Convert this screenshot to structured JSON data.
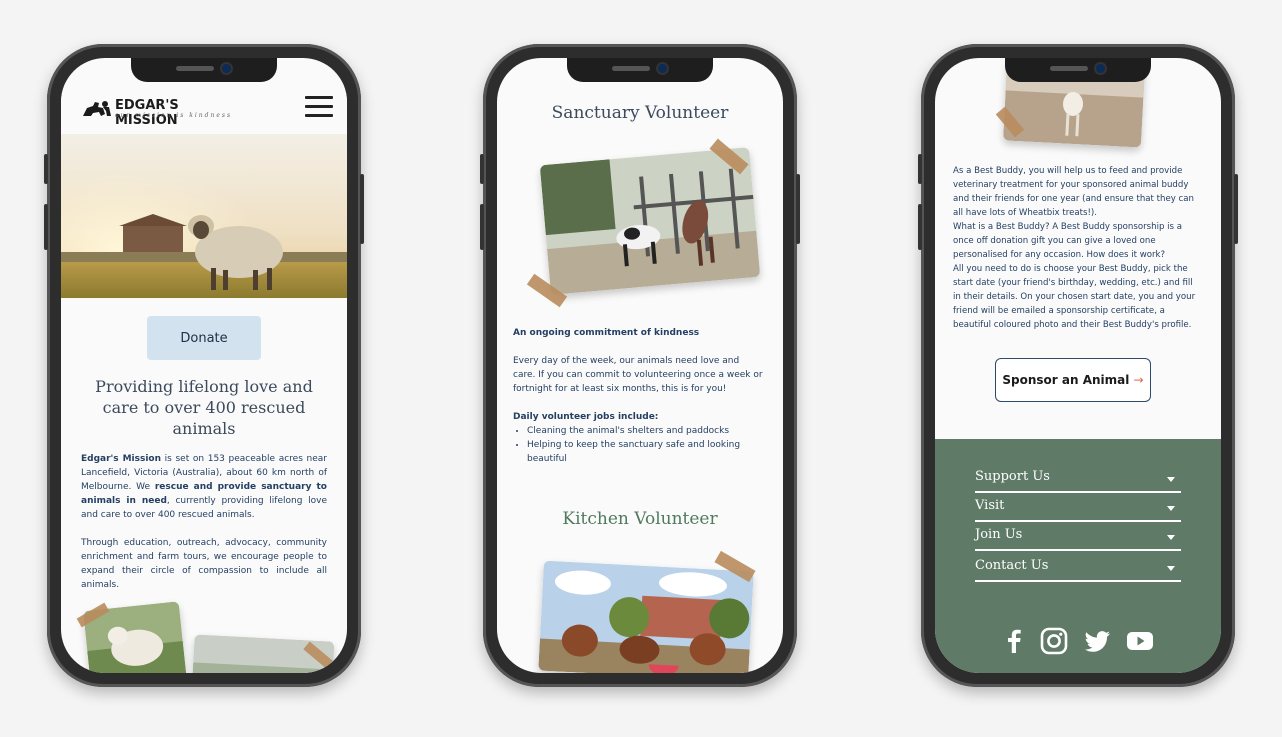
{
  "phone1": {
    "brand": "EDGAR'S MISSION",
    "tagline": "our mission is kindness",
    "donate_label": "Donate",
    "heading": "Providing lifelong love and care to over 400 rescued animals",
    "para1": {
      "s1": "Edgar's Mission",
      "s2": " is set on 153 peaceable acres near Lancefield, Victoria (Australia), about 60 km north of Melbourne. We ",
      "s3": "rescue and provide sanctuary to animals in need",
      "s4": ", currently providing lifelong love and care to over 400 rescued animals."
    },
    "para2": "Through education, outreach, advocacy, community enrichment and farm tours, we encourage people to expand their circle of compassion to include all animals."
  },
  "phone2": {
    "title1": "Sanctuary Volunteer",
    "intro_heading": "An ongoing commitment of kindness",
    "intro_body": "Every day of the week, our animals need love and care. If you can commit to volunteering once a week or fortnight for at least six months, this is for you!",
    "jobs_heading": "Daily volunteer jobs include:",
    "jobs": [
      "Cleaning the animal's shelters and paddocks",
      "Helping to keep the sanctuary safe and looking beautiful"
    ],
    "title2": "Kitchen Volunteer"
  },
  "phone3": {
    "p1": "As a Best Buddy, you will help us to feed and provide veterinary treatment for your sponsored animal buddy and their friends for one year (and ensure that they can all have lots of Wheatbix treats!).",
    "p2": "What is a Best Buddy? A Best Buddy sponsorship is a once off donation gift you can give a loved one personalised for any occasion. How does it work?",
    "p3": "All you need to do is choose your Best Buddy, pick the start date (your friend's birthday, wedding, etc.) and fill in their details. On your chosen start date, you and your friend will be emailed a sponsorship certificate, a beautiful coloured photo and their Best Buddy's profile.",
    "sponsor_label": "Sponsor an Animal",
    "sponsor_arrow": "→",
    "footer_items": [
      "Support Us",
      "Visit",
      "Join Us",
      "Contact Us"
    ],
    "social_icons": [
      "facebook-icon",
      "instagram-icon",
      "twitter-icon",
      "youtube-icon"
    ]
  },
  "colors": {
    "background": "#f4f4f4",
    "navy_text": "#243f63",
    "donate_bg": "#d3e2ef",
    "footer_green": "#5f7b67",
    "heading_green": "#4f7a5f",
    "arrow_orange": "#e06a4b"
  }
}
